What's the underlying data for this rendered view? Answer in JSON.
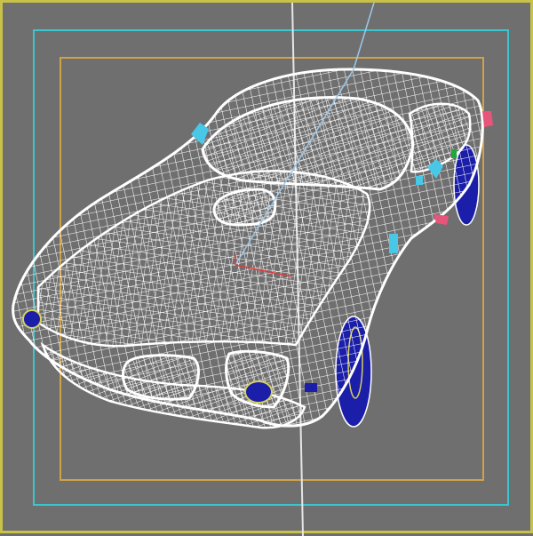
{
  "viewport": {
    "name": "perspective-viewport",
    "background_color": "#6f6f6f",
    "frame_color": "#c9c24a"
  },
  "safe_frames": {
    "action_safe_color": "#39c6cf",
    "title_safe_color": "#d1a246"
  },
  "model": {
    "type": "wireframe muscle car",
    "wire_color": "#ffffff",
    "accent_colors": {
      "mirror": "#49c7e6",
      "tail_light": "#e8557a",
      "wheel": "#1a1ea8",
      "headlight": "#1a1ea8",
      "marker_light": "#1fa83a"
    }
  },
  "gizmo": {
    "x_axis_color": "#e23a3a",
    "y_axis_color": "#9ec8e8"
  }
}
